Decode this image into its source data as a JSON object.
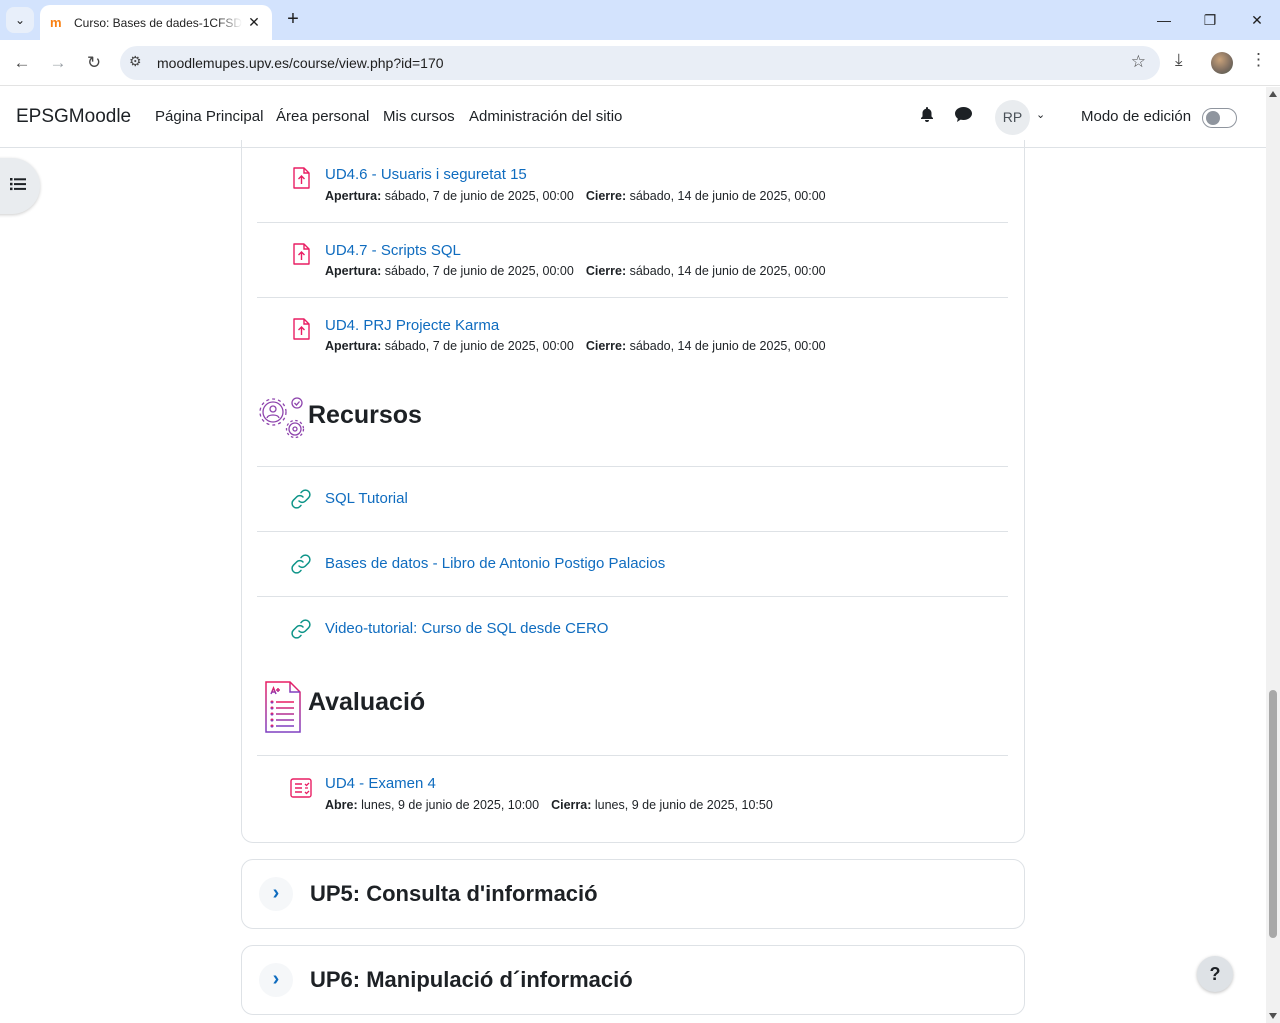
{
  "browser": {
    "tab_title": "Curso: Bases de dades-1CFSDAM",
    "tab_favicon": "moodle-favicon",
    "url": "moodlemupes.upv.es/course/view.php?id=170"
  },
  "navbar": {
    "brand": "EPSGMoodle",
    "links": [
      "Página Principal",
      "Área personal",
      "Mis cursos",
      "Administración del sitio"
    ],
    "avatar_initials": "RP",
    "edit_mode_label": "Modo de edición",
    "edit_mode_on": false
  },
  "upper_activities": [
    {
      "name": "UD4.6 - Usuaris i seguretat 15",
      "open_label": "Apertura:",
      "open": "sábado, 7 de junio de 2025, 00:00",
      "close_label": "Cierre:",
      "close": "sábado, 14 de junio de 2025, 00:00",
      "icon": "assignment-upload-icon"
    },
    {
      "name": "UD4.7 - Scripts SQL",
      "open_label": "Apertura:",
      "open": "sábado, 7 de junio de 2025, 00:00",
      "close_label": "Cierre:",
      "close": "sábado, 14 de junio de 2025, 00:00",
      "icon": "assignment-upload-icon"
    },
    {
      "name": "UD4. PRJ Projecte Karma",
      "open_label": "Apertura:",
      "open": "sábado, 7 de junio de 2025, 00:00",
      "close_label": "Cierre:",
      "close": "sábado, 14 de junio de 2025, 00:00",
      "icon": "assignment-upload-icon"
    }
  ],
  "resources_section": {
    "title": "Recursos",
    "items": [
      "SQL Tutorial",
      "Bases de datos - Libro de Antonio Postigo Palacios",
      "Video-tutorial: Curso de SQL desde CERO"
    ]
  },
  "evaluation_section": {
    "title": "Avaluació",
    "quiz": {
      "name": "UD4 - Examen 4",
      "open_label": "Abre:",
      "open": "lunes, 9 de junio de 2025, 10:00",
      "close_label": "Cierra:",
      "close": "lunes, 9 de junio de 2025, 10:50"
    }
  },
  "collapsed_sections": [
    "UP5: Consulta d'informació",
    "UP6: Manipulació d´informació"
  ],
  "help_label": "?",
  "colors": {
    "link": "#0f6cbf",
    "assign_icon": "#e91e63",
    "url_icon": "#0d9488",
    "quiz_icon": "#e91e63"
  }
}
